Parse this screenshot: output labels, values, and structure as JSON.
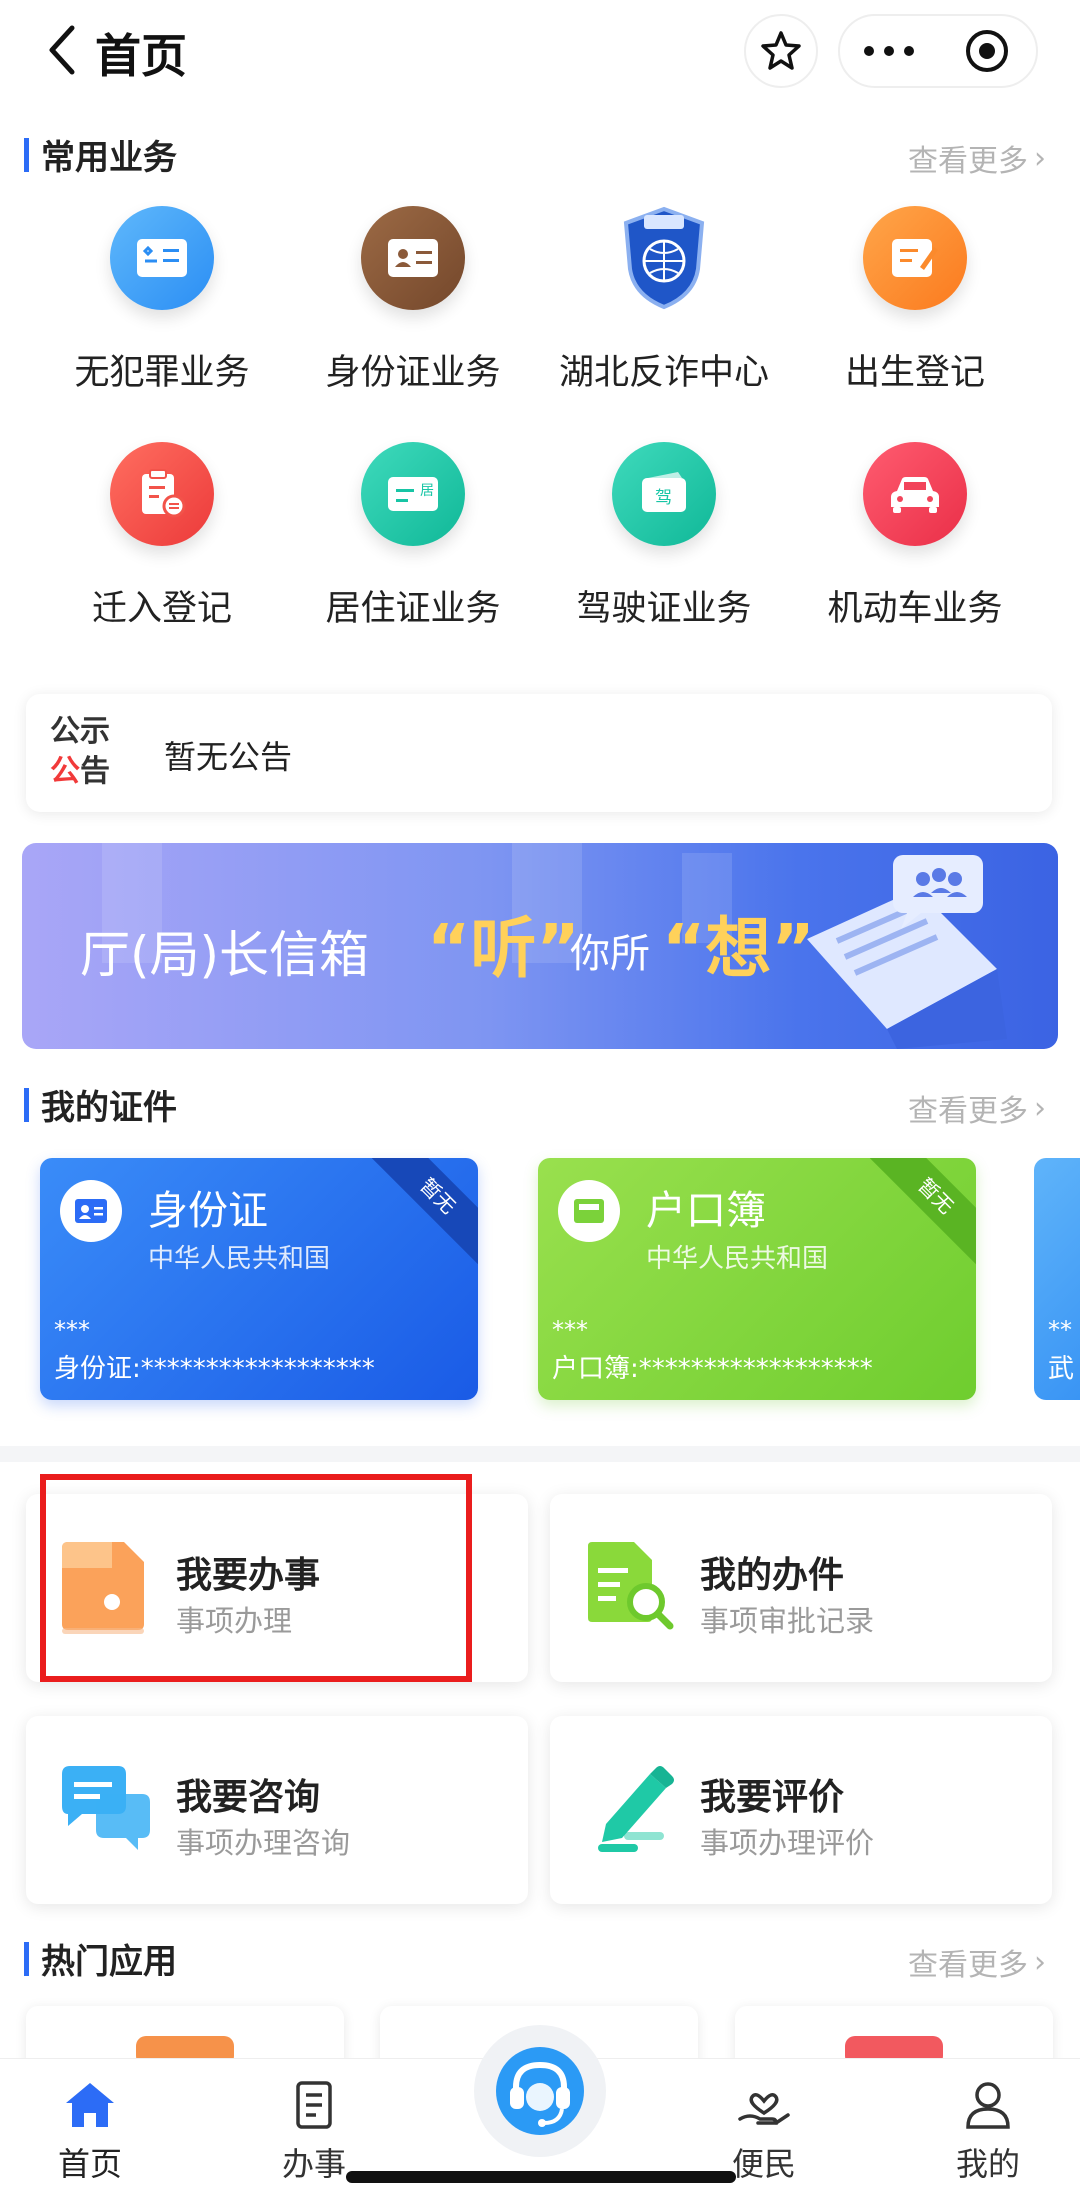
{
  "header": {
    "title": "首页"
  },
  "common": {
    "title": "常用业务",
    "more": "查看更多",
    "items": [
      {
        "label": "无犯罪业务",
        "icon": "id-card-icon",
        "color": "#3aa0f7"
      },
      {
        "label": "身份证业务",
        "icon": "id-card-icon",
        "color": "#8b5a3a"
      },
      {
        "label": "湖北反诈中心",
        "icon": "police-badge-icon",
        "color": "#1f4fb8"
      },
      {
        "label": "出生登记",
        "icon": "form-edit-icon",
        "color": "#fb8a2c"
      },
      {
        "label": "迁入登记",
        "icon": "clipboard-transfer-icon",
        "color": "#f2534a"
      },
      {
        "label": "居住证业务",
        "icon": "residence-card-icon",
        "color": "#17c5a5"
      },
      {
        "label": "驾驶证业务",
        "icon": "license-card-icon",
        "color": "#17c5a5"
      },
      {
        "label": "机动车业务",
        "icon": "car-icon",
        "color": "#f2445a"
      }
    ]
  },
  "notice": {
    "tag_line1": "公示",
    "tag_line2_red": "公",
    "tag_line2_rest": "告",
    "text": "暂无公告"
  },
  "banner": {
    "text1": "厅(局)长信箱",
    "text2": "“听”",
    "text3": "你所",
    "text4": "“想”"
  },
  "certs": {
    "title": "我的证件",
    "more": "查看更多",
    "cards": [
      {
        "name": "身份证",
        "sub": "中华人民共和国",
        "ribbon": "暂无",
        "stars": "***",
        "num": "身份证:******************",
        "color1": "#2f7df5",
        "color2": "#1b5fe6"
      },
      {
        "name": "户口簿",
        "sub": "中华人民共和国",
        "ribbon": "暂无",
        "stars": "***",
        "num": "户口簿:******************",
        "color1": "#8fdc45",
        "color2": "#6fcd2f"
      }
    ],
    "peek": {
      "stars": "**",
      "num": "武"
    }
  },
  "actions": [
    {
      "title": "我要办事",
      "sub": "事项办理",
      "icon": "folder-icon"
    },
    {
      "title": "我的办件",
      "sub": "事项审批记录",
      "icon": "document-search-icon"
    },
    {
      "title": "我要咨询",
      "sub": "事项办理咨询",
      "icon": "chat-bubbles-icon"
    },
    {
      "title": "我要评价",
      "sub": "事项办理评价",
      "icon": "pen-icon"
    }
  ],
  "hot": {
    "title": "热门应用",
    "more": "查看更多"
  },
  "tabs": [
    {
      "label": "首页",
      "icon": "home-icon"
    },
    {
      "label": "办事",
      "icon": "document-icon"
    },
    {
      "label": "",
      "icon": "customer-service-icon"
    },
    {
      "label": "便民",
      "icon": "hand-heart-icon"
    },
    {
      "label": "我的",
      "icon": "user-icon"
    }
  ],
  "accent": "#2c6cf6"
}
